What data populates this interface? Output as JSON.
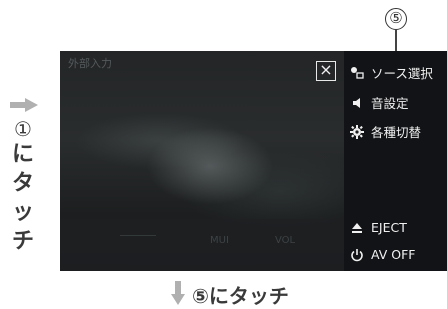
{
  "instruction_side": {
    "step_number": "①",
    "chars": [
      "に",
      "タ",
      "ッ",
      "チ"
    ]
  },
  "callout": {
    "number": "⑤"
  },
  "screen": {
    "video_title": "外部入力",
    "close_label": "×",
    "ghost_controls": [
      "MUI",
      "VOL"
    ],
    "menu": [
      {
        "icon": "source-icon",
        "label": "ソース選択"
      },
      {
        "icon": "speaker-icon",
        "label": "音設定"
      },
      {
        "icon": "gear-icon",
        "label": "各種切替"
      },
      {
        "icon": "eject-icon",
        "label": "EJECT"
      },
      {
        "icon": "power-icon",
        "label": "AV OFF"
      }
    ]
  },
  "instruction_bottom": {
    "text": "⑤にタッチ"
  },
  "colors": {
    "arrow": "#b0b0b0",
    "text": "#3a3a3a",
    "screen_bg": "#1d1f21",
    "menu_text": "#f0f0f0"
  }
}
